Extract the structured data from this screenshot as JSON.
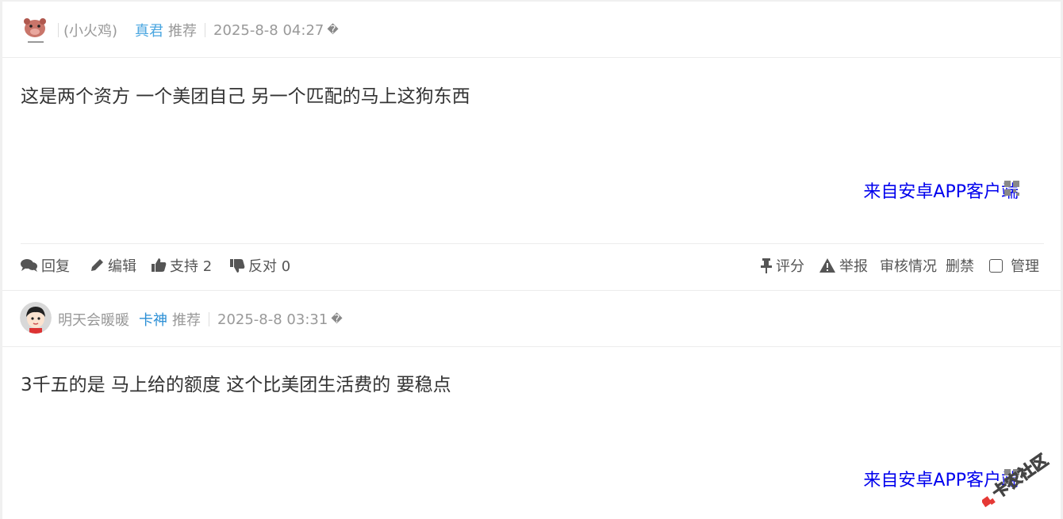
{
  "posts": [
    {
      "username": "(小火鸡)",
      "rank": "真君",
      "recommend": "推荐",
      "time": "2025-8-8 04:27",
      "glyph": "�",
      "content": "这是两个资方  一个美团自己  另一个匹配的马上这狗东西",
      "client": "来自安卓APP客户端",
      "avatar_icon": "cartoon-pig-avatar"
    },
    {
      "username": "明天会暖暖",
      "rank": "卡神",
      "recommend": "推荐",
      "time": "2025-8-8 03:31",
      "glyph": "�",
      "content": "3千五的是 马上给的额度  这个比美团生活费的 要稳点",
      "client": "来自安卓APP客户端",
      "avatar_icon": "cartoon-boy-avatar"
    }
  ],
  "actions": {
    "reply": "回复",
    "edit": "编辑",
    "support": "支持 2",
    "oppose": "反对 0",
    "rate": "评分",
    "report": "举报",
    "review": "审核情况",
    "ban": "删禁",
    "manage": "管理"
  },
  "watermark": "卡农社区",
  "colors": {
    "link_blue": "#0000ee",
    "rank_blue": "#4aa6e0",
    "meta_gray": "#999999",
    "text": "#333333"
  }
}
